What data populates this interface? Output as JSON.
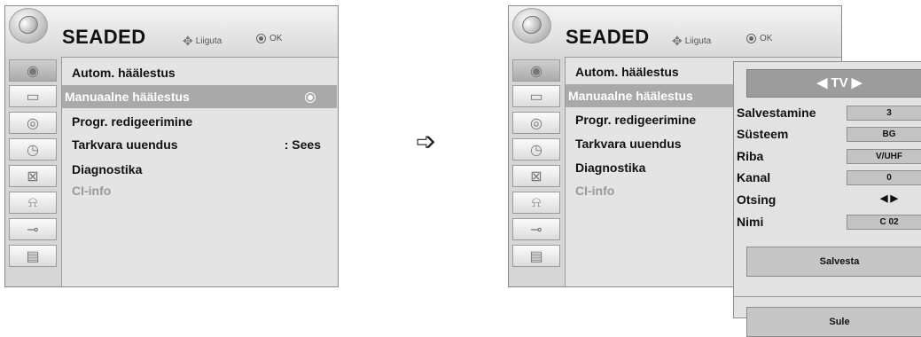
{
  "left": {
    "title": "SEADED",
    "nav_hint": "Liiguta",
    "ok_hint": "OK",
    "items": [
      {
        "label": "Autom. häälestus",
        "value": ""
      },
      {
        "label": "Manuaalne häälestus",
        "value": ""
      },
      {
        "label": "Progr. redigeerimine",
        "value": ""
      },
      {
        "label": "Tarkvara uuendus",
        "value": ": Sees"
      },
      {
        "label": "Diagnostika",
        "value": ""
      },
      {
        "label": "CI-info",
        "value": ""
      }
    ]
  },
  "arrow": "➩",
  "right": {
    "title": "SEADED",
    "nav_hint": "Liiguta",
    "ok_hint": "OK",
    "items": [
      {
        "label": "Autom. häälestus"
      },
      {
        "label": "Manuaalne häälestus"
      },
      {
        "label": "Progr. redigeerimine"
      },
      {
        "label": "Tarkvara uuendus"
      },
      {
        "label": "Diagnostika"
      },
      {
        "label": "CI-info"
      }
    ]
  },
  "submenu": {
    "header": "◀ TV ▶",
    "rows": [
      {
        "label": "Salvestamine",
        "value": "3"
      },
      {
        "label": "Süsteem",
        "value": "BG"
      },
      {
        "label": "Riba",
        "value": "V/UHF"
      },
      {
        "label": "Kanal",
        "value": "0"
      },
      {
        "label": "Otsing",
        "value": "◀ ▶"
      },
      {
        "label": "Nimi",
        "value": "C 02"
      }
    ],
    "save_button": "Salvesta",
    "close_button": "Sule"
  },
  "icons": [
    "satellite-icon",
    "monitor-icon",
    "speaker-icon",
    "clock-icon",
    "lock-schedule-icon",
    "padlock-icon",
    "connector-icon",
    "clapperboard-icon"
  ]
}
